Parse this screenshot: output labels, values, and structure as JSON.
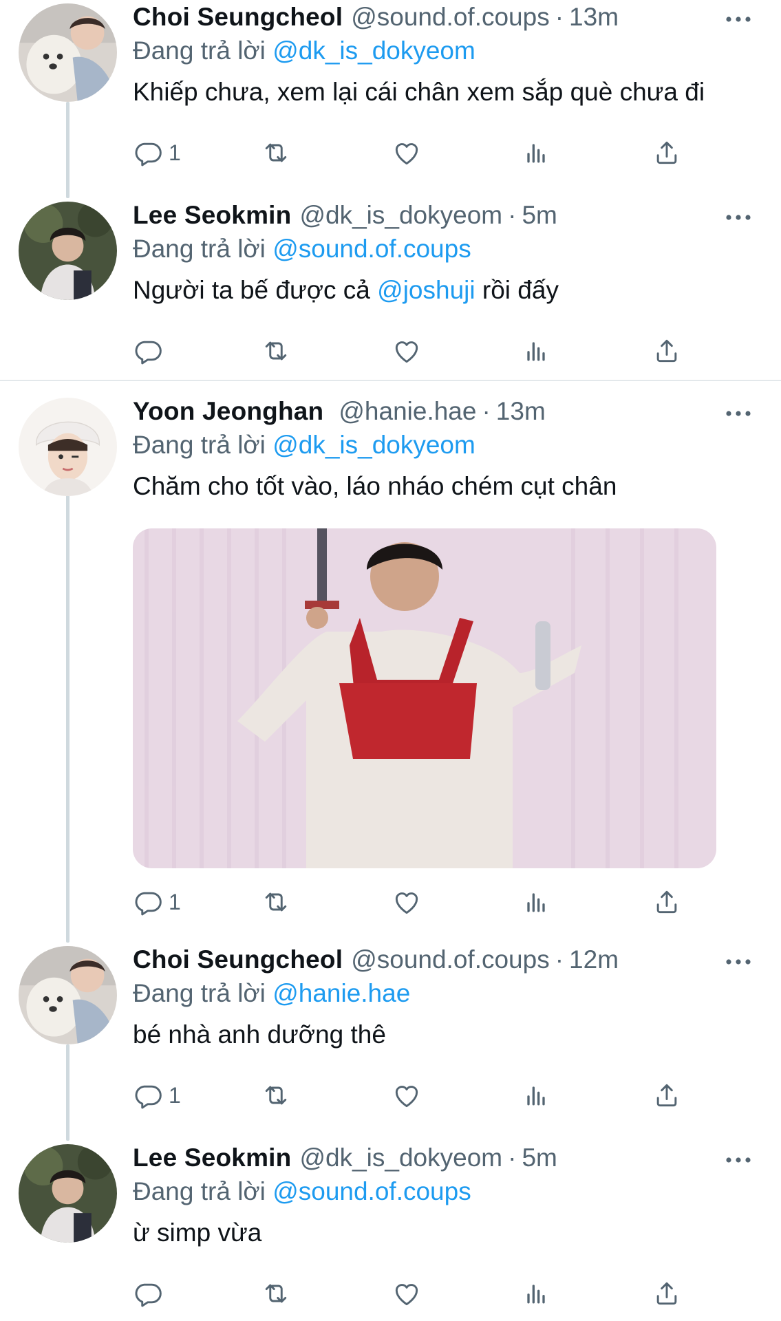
{
  "reply_prefix": "Đang trả lời",
  "colors": {
    "accent": "#1d9bf0",
    "muted": "#536471",
    "text": "#0f1419",
    "thread_line": "#cfd9de"
  },
  "icons": [
    "more-icon",
    "reply-icon",
    "retweet-icon",
    "like-icon",
    "views-icon",
    "share-icon"
  ],
  "tweets": [
    {
      "name": "Choi Seungcheol",
      "handle": "@sound.of.coups",
      "sep": "·",
      "time": "13m",
      "reply_to": "@dk_is_dokyeom",
      "text": "Khiếp chưa, xem lại cái chân xem sắp què chưa đi",
      "reply_count": "1"
    },
    {
      "name": "Lee Seokmin",
      "handle": "@dk_is_dokyeom",
      "sep": "·",
      "time": "5m",
      "reply_to": "@sound.of.coups",
      "text_before": "Người ta bế được cả ",
      "text_mention": "@joshuji",
      "text_after": " rồi đấy",
      "reply_count": ""
    },
    {
      "name": "Yoon Jeonghan",
      "handle": "@hanie.hae",
      "sep": "·",
      "time": "13m",
      "reply_to": "@dk_is_dokyeom",
      "text": "Chăm cho tốt vào, láo nháo chém cụt chân",
      "reply_count": "1"
    },
    {
      "name": "Choi Seungcheol",
      "handle": "@sound.of.coups",
      "sep": "·",
      "time": "12m",
      "reply_to": "@hanie.hae",
      "text": "bé nhà anh dưỡng thê",
      "reply_count": "1"
    },
    {
      "name": "Lee Seokmin",
      "handle": "@dk_is_dokyeom",
      "sep": "·",
      "time": "5m",
      "reply_to": "@sound.of.coups",
      "text": "ừ simp vừa",
      "reply_count": ""
    }
  ]
}
